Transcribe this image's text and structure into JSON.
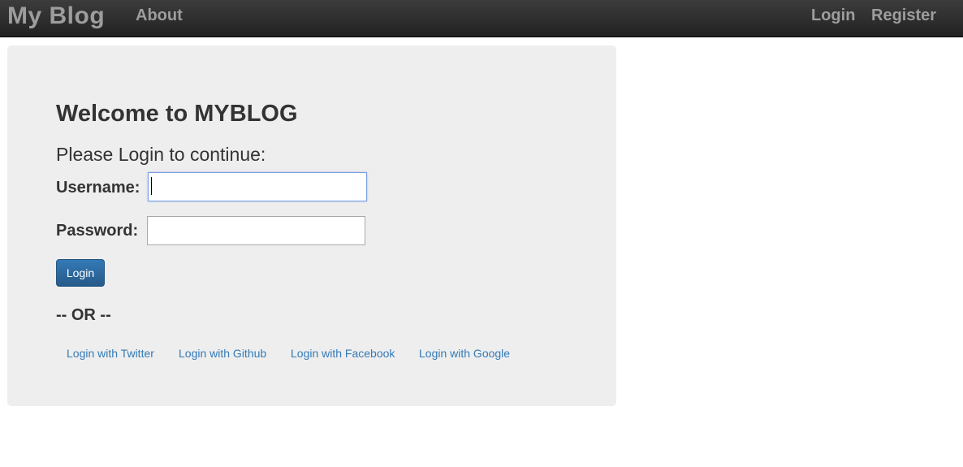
{
  "navbar": {
    "brand": "My Blog",
    "about": "About",
    "login": "Login",
    "register": "Register"
  },
  "main": {
    "heading": "Welcome to MYBLOG",
    "subtitle": "Please Login to continue:",
    "form": {
      "username_label": "Username:",
      "username_value": "",
      "password_label": "Password:",
      "password_value": "",
      "login_button": "Login"
    },
    "or_text": "-- OR --",
    "social_logins": {
      "twitter": "Login with Twitter",
      "github": "Login with Github",
      "facebook": "Login with Facebook",
      "google": "Login with Google"
    }
  },
  "colors": {
    "navbar_bg": "#222222",
    "nav_text": "#9d9d9d",
    "panel_bg": "#eeeeee",
    "primary": "#337ab7",
    "link": "#337ab7"
  }
}
